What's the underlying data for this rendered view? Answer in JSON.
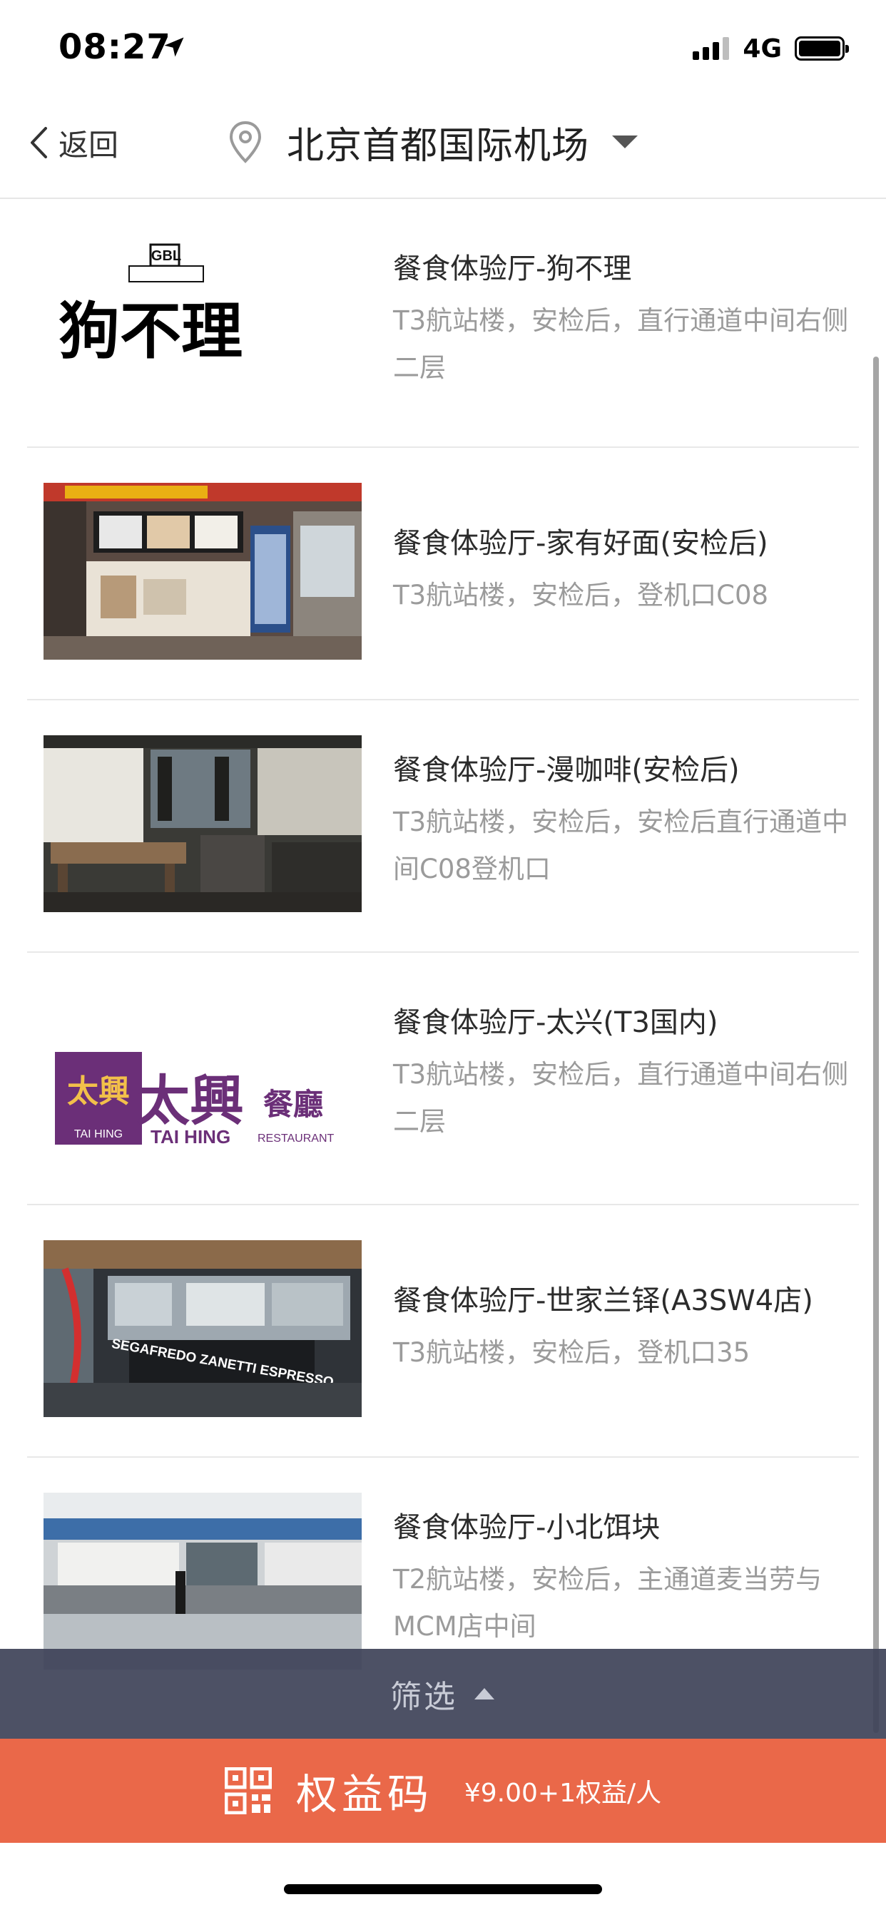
{
  "status_bar": {
    "time": "08:27",
    "network": "4G"
  },
  "header": {
    "back_label": "返回",
    "location": "北京首都国际机场"
  },
  "items": [
    {
      "title": "餐食体验厅-狗不理",
      "address": "T3航站楼，安检后，直行通道中间右侧二层",
      "thumb": "goubuli-logo",
      "logo_text": "狗不理",
      "logo_small": "狗不理"
    },
    {
      "title": "餐食体验厅-家有好面(安检后)",
      "address": "T3航站楼，安检后，登机口C08",
      "thumb": "noodle-shop-photo"
    },
    {
      "title": "餐食体验厅-漫咖啡(安检后)",
      "address": "T3航站楼，安检后，安检后直行通道中间C08登机口",
      "thumb": "cafe-interior-photo"
    },
    {
      "title": "餐食体验厅-太兴(T3国内)",
      "address": "T3航站楼，安检后，直行通道中间右侧二层",
      "thumb": "taihing-logo",
      "logo_box_text": "太興",
      "logo_box_sub": "TAI HING",
      "logo_cn": "太興",
      "logo_cn2": "餐廳",
      "logo_en": "TAI HING",
      "logo_en2": "RESTAURANT"
    },
    {
      "title": "餐食体验厅-世家兰铎(A3SW4店)",
      "address": "T3航站楼，安检后，登机口35",
      "thumb": "espresso-bar-photo",
      "sign_text": "SEGAFREDO ZANETTI ESPRESSO"
    },
    {
      "title": "餐食体验厅-小北饵块",
      "address": "T2航站楼，安检后，主通道麦当劳与MCM店中间",
      "thumb": "food-court-photo"
    }
  ],
  "filter": {
    "label": "筛选"
  },
  "cta": {
    "label": "权益码",
    "price": "¥9.00+1权益/人"
  },
  "colors": {
    "cta_bg": "#ea6849",
    "filter_bg": "#3e4258",
    "title_text": "#2b2b2b",
    "address_text": "#9b9b9b"
  }
}
